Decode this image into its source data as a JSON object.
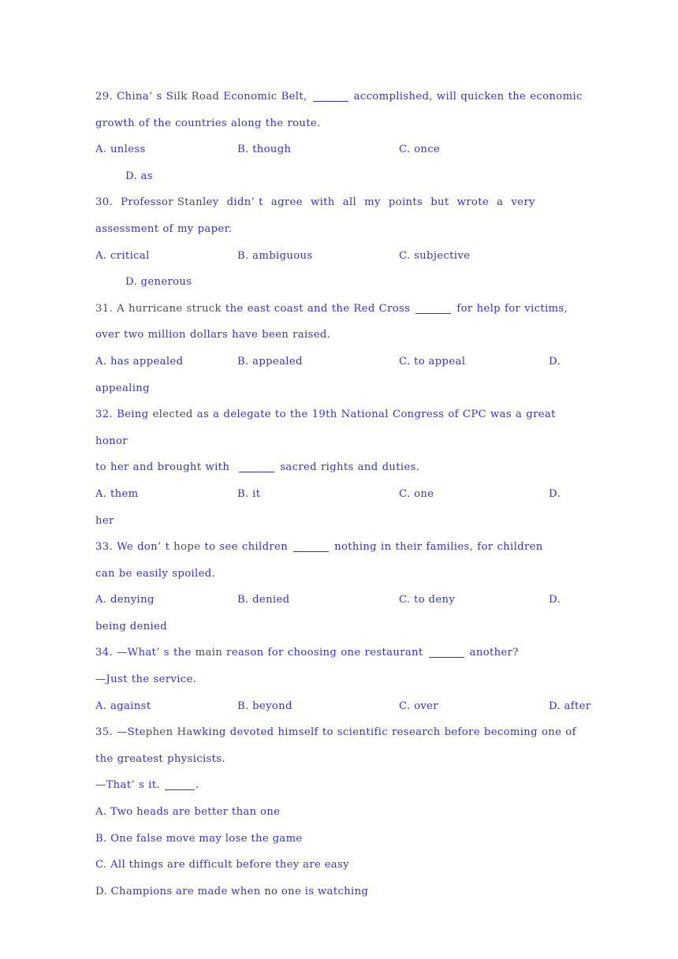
{
  "document": {
    "type": "exam-worksheet",
    "language": "English",
    "section": "multiple-choice-grammar",
    "text_color": "#3333cc",
    "secondary_text_color": "#4a4a52",
    "background_color": "#ffffff"
  },
  "questions": [
    {
      "number": "29.",
      "stem_lines": [
        "29. China’s Silk Road Economic Belt, ____ accomplished, will quicken the economic",
        "growth of the countries along the route."
      ],
      "stem_part_1": "29. China’ s S",
      "stem_part_2": "ilk Road",
      "stem_part_3": " Economic Belt, ",
      "stem_part_4": " accomplished, will quicken the economic",
      "stem_line_2": "growth of the countries along the route.",
      "options_row": [
        {
          "label": "A.",
          "text": "unless"
        },
        {
          "label": "B.",
          "text": "though"
        },
        {
          "label": "C.",
          "text": "once"
        }
      ],
      "options_wrap": [
        {
          "label": "D.",
          "text": "as"
        }
      ]
    },
    {
      "number": "30.",
      "stem_part_1": "30.  Professo",
      "stem_part_2": "r Stan",
      "stem_part_3": "ley  didn’ t  agree  with  all  my  points  but  wrote  a  very",
      "stem_line_2": "assessment of my paper.",
      "options_row": [
        {
          "label": "A.",
          "text": "critical"
        },
        {
          "label": "B.",
          "text": "ambiguous"
        },
        {
          "label": "C.",
          "text": "subjective"
        }
      ],
      "options_wrap": [
        {
          "label": "D.",
          "text": "generous"
        }
      ]
    },
    {
      "number": "31.",
      "stem_part_1": "31. A hurric",
      "stem_part_2": "ane struck",
      "stem_part_3": " the east coast and the Red Cross ",
      "stem_part_4": " for help for victims,",
      "stem_line_2": "over two million dollars have been raised.",
      "options_row": [
        {
          "label": "A.",
          "text": "has appealed"
        },
        {
          "label": "B.",
          "text": "appealed"
        },
        {
          "label": "C.",
          "text": "to appeal"
        },
        {
          "label": "D.",
          "text": ""
        }
      ],
      "options_wrap": [
        {
          "label": "",
          "text": "appealing"
        }
      ]
    },
    {
      "number": "32.",
      "stem_part_1": "32. Being ",
      "stem_part_2": "elected",
      "stem_part_3": " as a delegate to the 19th National Congress of CPC was a great honor",
      "stem_line_2_a": "to her and brought with  ",
      "stem_line_2_b": " sacred rights and duties.",
      "options_row": [
        {
          "label": "A.",
          "text": "them"
        },
        {
          "label": "B.",
          "text": "it"
        },
        {
          "label": "C.",
          "text": "one"
        },
        {
          "label": "D.",
          "text": ""
        }
      ],
      "options_wrap": [
        {
          "label": "",
          "text": "her"
        }
      ]
    },
    {
      "number": "33.",
      "stem_part_1": "33. We don’ t ",
      "stem_part_2": "hope",
      "stem_part_3": " to see children ",
      "stem_part_4": " nothing in their families, for children",
      "stem_line_2": "can be easily spoiled.",
      "options_row": [
        {
          "label": "A.",
          "text": "denying"
        },
        {
          "label": "B.",
          "text": "denied"
        },
        {
          "label": "C.",
          "text": "to deny"
        },
        {
          "label": "D.",
          "text": ""
        }
      ],
      "options_wrap": [
        {
          "label": "",
          "text": "being denied"
        }
      ]
    },
    {
      "number": "34.",
      "stem_part_1": "34. —What’ s the ",
      "stem_part_2": "main",
      "stem_part_3": " reason for choosing one restaurant ",
      "stem_part_4": " another?",
      "stem_line_2": "—Just the service.",
      "options_row": [
        {
          "label": "A.",
          "text": "against"
        },
        {
          "label": "B.",
          "text": "beyond"
        },
        {
          "label": "C.",
          "text": "over"
        },
        {
          "label": "D.",
          "text": "after"
        }
      ],
      "options_wrap": []
    },
    {
      "number": "35.",
      "stem_part_1": "35. —Ste",
      "stem_part_2": "phen Ha",
      "stem_part_3": "wking devoted himself to scientific research before becoming one of",
      "stem_line_2": "the greatest physicists.",
      "stem_line_3_a": "—That’ s it. ",
      "stem_line_3_b": ".",
      "options_stacked": [
        {
          "label": "A.",
          "text": "Two heads are better than one"
        },
        {
          "label": "B.",
          "text": "One false move may lose the game"
        },
        {
          "label": "C.",
          "text": "All things are difficult before they are easy"
        },
        {
          "label": "D.",
          "text": "Champions are made when no one is watching"
        }
      ]
    }
  ]
}
